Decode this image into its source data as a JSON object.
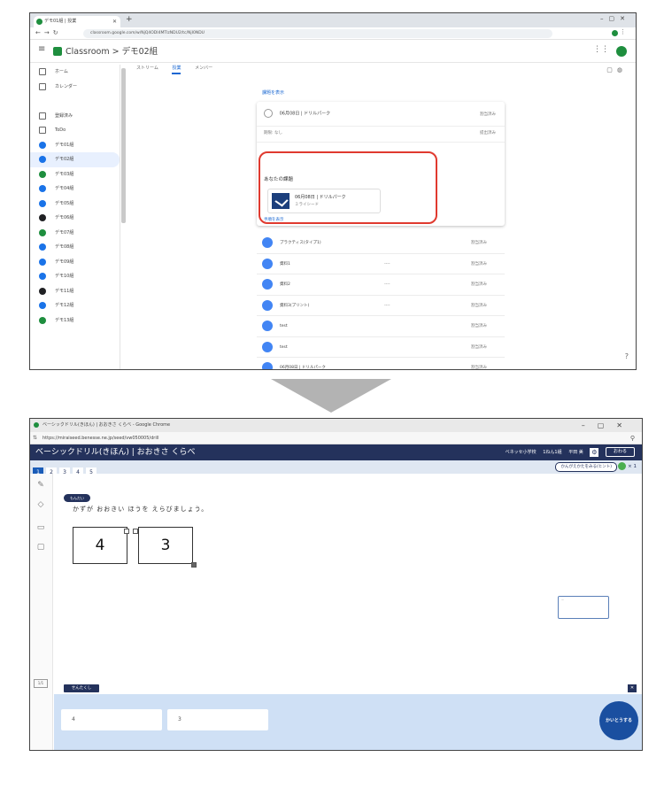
{
  "top": {
    "tab_title": "デモ01組 | 授業",
    "url": "classroom.google.com/w/NjQ4ODI4MTIzNDU2/tc/NjI0NDU",
    "app_title": "Classroom  >  デモ02組",
    "sidebar": {
      "items": [
        {
          "label": "ホーム",
          "icon": "home-icon"
        },
        {
          "label": "カレンダー",
          "icon": "calendar-icon"
        },
        {
          "label": "",
          "icon": "spacer"
        },
        {
          "label": "登録済み",
          "icon": "teach-icon"
        },
        {
          "label": "ToDo",
          "icon": "todo-icon"
        },
        {
          "label": "デモ01組",
          "color": "#1a73e8"
        },
        {
          "label": "デモ02組",
          "color": "#1a73e8",
          "active": true
        },
        {
          "label": "デモ03組",
          "color": "#1e8e3e"
        },
        {
          "label": "デモ04組",
          "color": "#1a73e8"
        },
        {
          "label": "デモ05組",
          "color": "#1a73e8"
        },
        {
          "label": "デモ06組",
          "color": "#202124"
        },
        {
          "label": "デモ07組",
          "color": "#1e8e3e"
        },
        {
          "label": "デモ08組",
          "color": "#1a73e8"
        },
        {
          "label": "デモ09組",
          "color": "#1a73e8"
        },
        {
          "label": "デモ10組",
          "color": "#1a73e8"
        },
        {
          "label": "デモ11組",
          "color": "#202124"
        },
        {
          "label": "デモ12組",
          "color": "#1a73e8"
        },
        {
          "label": "デモ13組",
          "color": "#1e8e3e"
        }
      ]
    },
    "tabs": [
      "ストリーム",
      "授業",
      "メンバー"
    ],
    "assignment_link": "課題を表示",
    "assignment_title": "06月08日 | ドリルパーク",
    "assignment_status": "割当済み",
    "meta_due": "期限: なし",
    "meta_graded": "提出済み",
    "your_work_heading": "あなたの課題",
    "attachment_name": "06月08日 | ドリルパーク",
    "attachment_sub": "ミライシード",
    "show_more": "手順を表示",
    "materials": [
      {
        "name": "プラクティス(タイプ1)",
        "mid": "",
        "status": "割当済み"
      },
      {
        "name": "資料1",
        "mid": "----",
        "status": "割当済み"
      },
      {
        "name": "資料2",
        "mid": "----",
        "status": "割当済み"
      },
      {
        "name": "資料3(プリント)",
        "mid": "----",
        "status": "割当済み"
      },
      {
        "name": "test",
        "mid": "",
        "status": "割当済み"
      },
      {
        "name": "test",
        "mid": "",
        "status": "割当済み"
      },
      {
        "name": "06月08日 | ドリルパーク",
        "mid": "",
        "status": "割当済み"
      }
    ]
  },
  "bottom": {
    "window_title": "ベーシックドリル(きほん) | おおきさ くらべ - Google Chrome",
    "url": "https://miraiseed.benesse.ne.jp/seed/vw050005/drill",
    "app_title": "ベーシックドリル(きほん) | おおきさ くらべ",
    "school": "ベネッセ小学校",
    "grade_class": "1ねん1組",
    "student": "平田 美",
    "close_label": "おわる",
    "question_numbers": [
      "1",
      "2",
      "3",
      "4",
      "5"
    ],
    "active_question": "1",
    "hint_label": "かんがえかたをみる(ヒント)",
    "score": "× 1",
    "question_tag": "もんだい",
    "question_text": "かずが おおきい ほうを えらびましょう。",
    "card_left": "4",
    "card_right": "3",
    "page_label": "1/1",
    "answer_tag": "せんたくし",
    "answer_options": [
      "4",
      "3"
    ],
    "submit_label": "かいとうする"
  }
}
